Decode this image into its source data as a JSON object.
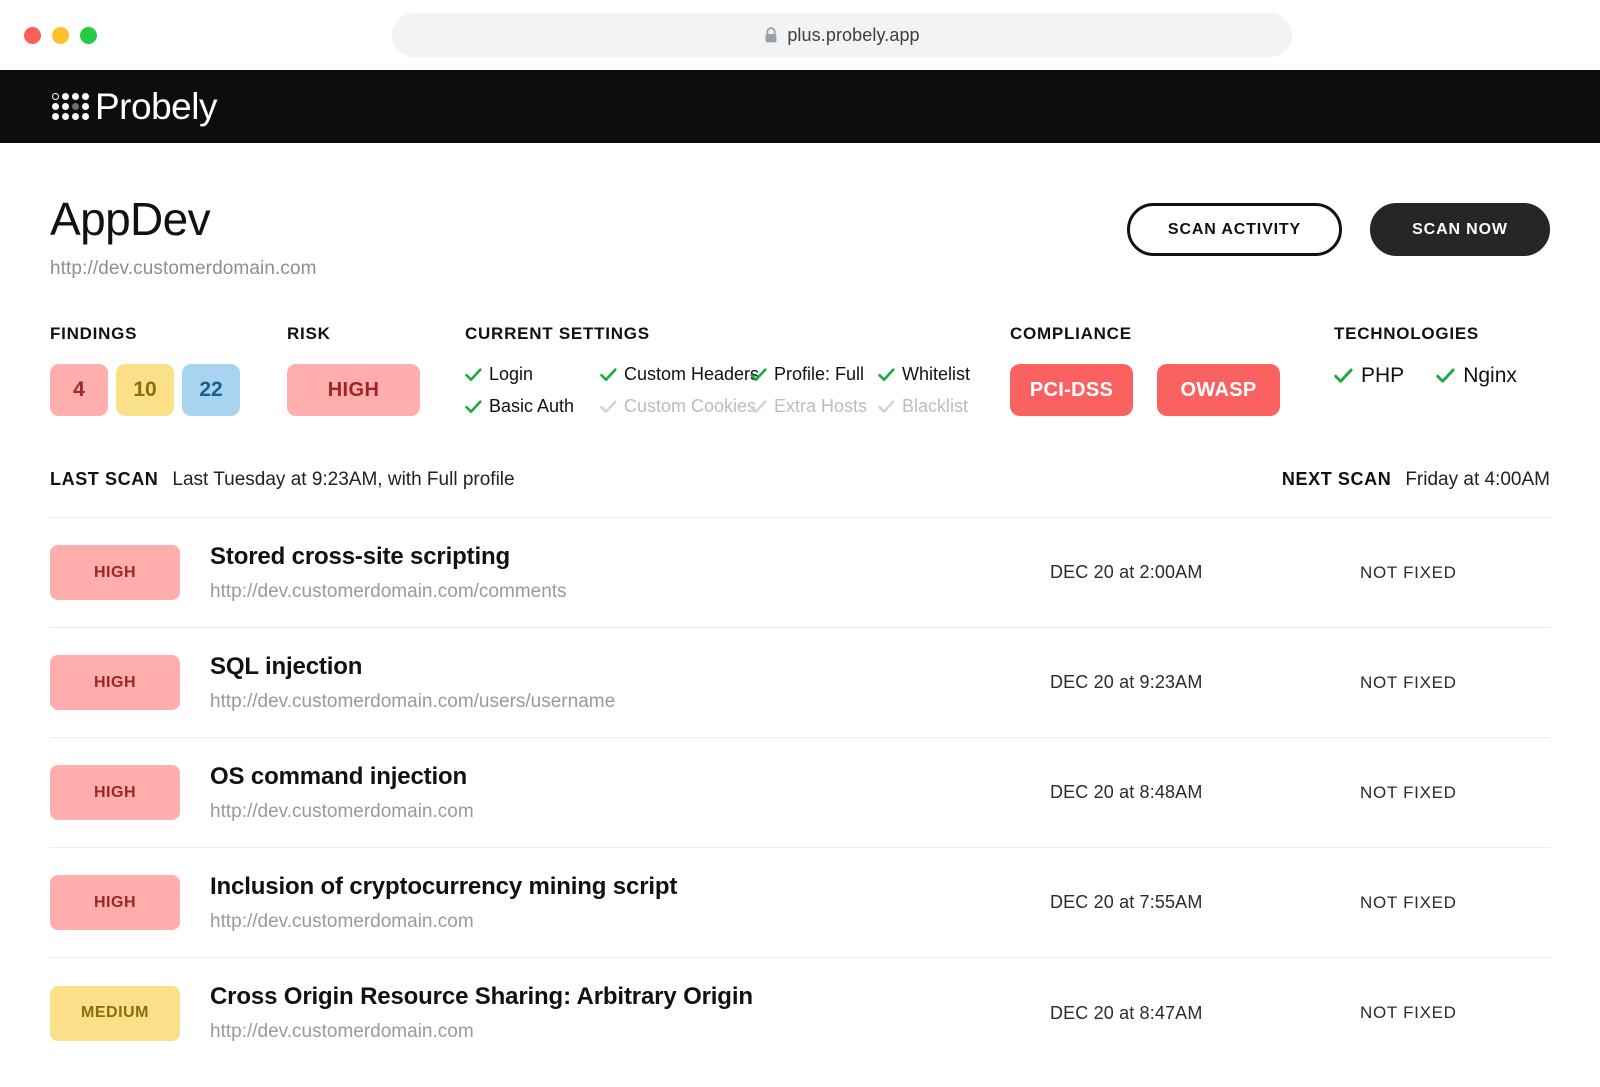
{
  "browser": {
    "url": "plus.probely.app",
    "lock_icon": "lock-icon",
    "traffic_lights": [
      "close",
      "minimize",
      "maximize"
    ]
  },
  "topbar": {
    "brand": "Probely"
  },
  "header": {
    "title": "AppDev",
    "url": "http://dev.customerdomain.com",
    "scan_activity_label": "SCAN ACTIVITY",
    "scan_now_label": "SCAN NOW"
  },
  "stats": {
    "findings": {
      "label": "FINDINGS",
      "chips": [
        {
          "value": "4",
          "tone": "pink"
        },
        {
          "value": "10",
          "tone": "yellow"
        },
        {
          "value": "22",
          "tone": "blue"
        }
      ]
    },
    "risk": {
      "label": "RISK",
      "value": "HIGH"
    },
    "current_settings": {
      "label": "CURRENT SETTINGS",
      "items": [
        {
          "name": "Login",
          "enabled": true
        },
        {
          "name": "Custom Headers",
          "enabled": true
        },
        {
          "name": "Profile: Full",
          "enabled": true
        },
        {
          "name": "Whitelist",
          "enabled": true
        },
        {
          "name": "Basic Auth",
          "enabled": true
        },
        {
          "name": "Custom Cookies",
          "enabled": false
        },
        {
          "name": "Extra Hosts",
          "enabled": false
        },
        {
          "name": "Blacklist",
          "enabled": false
        }
      ]
    },
    "compliance": {
      "label": "COMPLIANCE",
      "badges": [
        "PCI-DSS",
        "OWASP"
      ]
    },
    "technologies": {
      "label": "TECHNOLOGIES",
      "items": [
        "PHP",
        "Nginx"
      ]
    }
  },
  "scan_info": {
    "last_scan_label": "LAST SCAN",
    "last_scan_value": "Last Tuesday at 9:23AM, with Full profile",
    "next_scan_label": "NEXT SCAN",
    "next_scan_value": "Friday at 4:00AM"
  },
  "findings_table": {
    "rows": [
      {
        "severity": "HIGH",
        "severity_tone": "high",
        "title": "Stored cross-site scripting",
        "url": "http://dev.customerdomain.com/comments",
        "date": "DEC 20 at 2:00AM",
        "status": "NOT FIXED"
      },
      {
        "severity": "HIGH",
        "severity_tone": "high",
        "title": "SQL injection",
        "url": "http://dev.customerdomain.com/users/username",
        "date": "DEC 20 at 9:23AM",
        "status": "NOT FIXED"
      },
      {
        "severity": "HIGH",
        "severity_tone": "high",
        "title": "OS command injection",
        "url": "http://dev.customerdomain.com",
        "date": "DEC 20 at 8:48AM",
        "status": "NOT FIXED"
      },
      {
        "severity": "HIGH",
        "severity_tone": "high",
        "title": "Inclusion of cryptocurrency mining script",
        "url": "http://dev.customerdomain.com",
        "date": "DEC 20 at 7:55AM",
        "status": "NOT FIXED"
      },
      {
        "severity": "MEDIUM",
        "severity_tone": "medium",
        "title": "Cross Origin Resource Sharing: Arbitrary Origin",
        "url": "http://dev.customerdomain.com",
        "date": "DEC 20 at 8:47AM",
        "status": "NOT FIXED"
      }
    ]
  },
  "colors": {
    "brand_black": "#0d0d0d",
    "severity_high_bg": "#ffadad",
    "severity_high_fg": "#9c2626",
    "severity_medium_bg": "#fbe08a",
    "severity_medium_fg": "#8a6d10",
    "info_bg": "#a8d4f0",
    "info_fg": "#15618f",
    "compliance_bg": "#fa6262",
    "check_green": "#1cab3c",
    "check_disabled": "#d4d4d4"
  }
}
